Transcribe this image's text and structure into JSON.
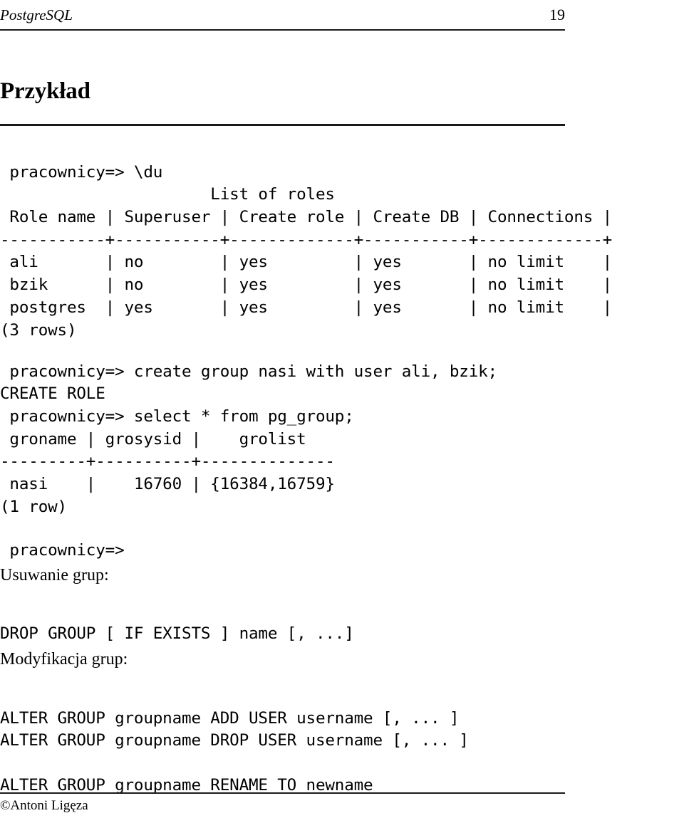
{
  "running_head": {
    "title": "PostgreSQL",
    "page_number": "19"
  },
  "section": {
    "heading": "Przykład"
  },
  "terminal": {
    "du_block": " pracownicy=> \\du\n                      List of roles\n Role name | Superuser | Create role | Create DB | Connections |\n-----------+-----------+-------------+-----------+-------------+\n ali       | no        | yes         | yes       | no limit    |\n bzik      | no        | yes         | yes       | no limit    |\n postgres  | yes       | yes         | yes       | no limit    |\n(3 rows)",
    "create_block": " pracownicy=> create group nasi with user ali, bzik;\nCREATE ROLE\n pracownicy=> select * from pg_group;\n groname | grosysid |    grolist\n---------+----------+--------------\n nasi    |    16760 | {16384,16759}\n(1 row)",
    "prompt_block": " pracownicy=>",
    "drop_group": "DROP GROUP [ IF EXISTS ] name [, ...]",
    "alter_group": "ALTER GROUP groupname ADD USER username [, ... ]\nALTER GROUP groupname DROP USER username [, ... ]",
    "rename_group": "ALTER GROUP groupname RENAME TO newname"
  },
  "body": {
    "usuwanie_label": "Usuwanie grup:",
    "modyfikacja_label": "Modyfikacja grup:"
  },
  "footer": {
    "credit": "©Antoni Ligęza"
  },
  "roles_table": {
    "title": "List of roles",
    "columns": [
      "Role name",
      "Superuser",
      "Create role",
      "Create DB",
      "Connections"
    ],
    "rows": [
      [
        "ali",
        "no",
        "yes",
        "yes",
        "no limit"
      ],
      [
        "bzik",
        "no",
        "yes",
        "yes",
        "no limit"
      ],
      [
        "postgres",
        "yes",
        "yes",
        "yes",
        "no limit"
      ]
    ],
    "row_count_label": "(3 rows)"
  },
  "pg_group_table": {
    "columns": [
      "groname",
      "grosysid",
      "grolist"
    ],
    "rows": [
      [
        "nasi",
        "16760",
        "{16384,16759}"
      ]
    ],
    "row_count_label": "(1 row)"
  },
  "commands": {
    "psql_meta": "\\du",
    "create_group": "create group nasi with user ali, bzik;",
    "create_result": "CREATE ROLE",
    "select_pg_group": "select * from pg_group;",
    "prompt": "pracownicy=>"
  },
  "colors": {
    "text": "#000000",
    "rule": "#1a1a1a",
    "background": "#ffffff"
  }
}
